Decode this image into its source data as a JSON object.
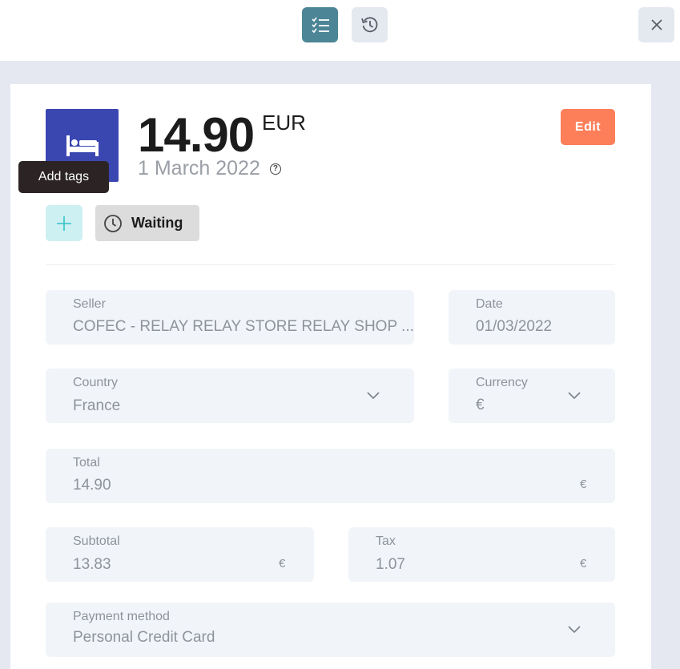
{
  "toolbar": {
    "details_icon": "checklist-icon",
    "history_icon": "history-icon",
    "close_icon": "close-icon"
  },
  "expense": {
    "category_icon": "bed-icon",
    "amount": "14.90",
    "currency_code": "EUR",
    "date": "1 March 2022",
    "edit_label": "Edit",
    "tooltip": "Add tags",
    "status": "Waiting",
    "status_icon": "clock-icon"
  },
  "fields": {
    "seller": {
      "label": "Seller",
      "value": "COFEC - RELAY RELAY STORE RELAY SHOP ..."
    },
    "date": {
      "label": "Date",
      "value": "01/03/2022"
    },
    "country": {
      "label": "Country",
      "value": "France"
    },
    "currency": {
      "label": "Currency",
      "value": "€"
    },
    "total": {
      "label": "Total",
      "value": "14.90",
      "unit": "€"
    },
    "subtotal": {
      "label": "Subtotal",
      "value": "13.83",
      "unit": "€"
    },
    "tax": {
      "label": "Tax",
      "value": "1.07",
      "unit": "€"
    },
    "payment_method": {
      "label": "Payment method",
      "value": "Personal Credit Card"
    }
  },
  "colors": {
    "accent_teal": "#4b8596",
    "edit_orange": "#fd7f5a",
    "category_blue": "#3b47b1",
    "field_bg": "#f1f4f8"
  }
}
